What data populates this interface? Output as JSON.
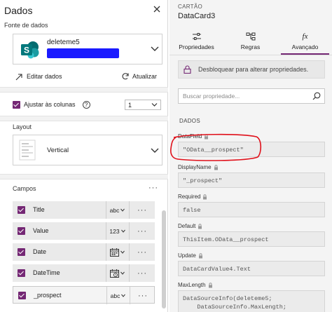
{
  "left_panel": {
    "title": "Dados",
    "data_source_label": "Fonte de dados",
    "data_source_name": "deleteme5",
    "edit_label": "Editar dados",
    "refresh_label": "Atualizar",
    "fit_columns_label": "Ajustar às colunas",
    "columns_value": "1",
    "layout_label": "Layout",
    "layout_value": "Vertical",
    "fields_label": "Campos",
    "fields": [
      {
        "name": "Title",
        "type": "abc"
      },
      {
        "name": "Value",
        "type": "123"
      },
      {
        "name": "Date",
        "type": "calendar-icon"
      },
      {
        "name": "DateTime",
        "type": "calendar-clock-icon"
      },
      {
        "name": "_prospect",
        "type": "abc"
      }
    ]
  },
  "right_panel": {
    "card_label": "CARTÃO",
    "card_name": "DataCard3",
    "tabs": [
      {
        "label": "Propriedades",
        "icon": "sliders-icon"
      },
      {
        "label": "Regras",
        "icon": "rules-icon"
      },
      {
        "label": "Avançado",
        "icon": "fx-icon",
        "active": true
      }
    ],
    "fx_glyph": "fx",
    "unlock_text": "Desbloquear para alterar propriedades.",
    "search_placeholder": "Buscar propriedade...",
    "section_header": "DADOS",
    "properties": [
      {
        "name": "DataField",
        "value": "\"OData__prospect\""
      },
      {
        "name": "DisplayName",
        "value": "\"_prospect\""
      },
      {
        "name": "Required",
        "value": "false"
      },
      {
        "name": "Default",
        "value": "ThisItem.OData__prospect"
      },
      {
        "name": "Update",
        "value": "DataCardValue4.Text"
      },
      {
        "name": "MaxLength",
        "value": "DataSourceInfo(deleteme5;\n    DataSourceInfo.MaxLength;"
      }
    ]
  },
  "colors": {
    "accent": "#742774",
    "sharepoint": "#036c70",
    "annotation_red": "#e0101a",
    "redaction": "#1a1aff"
  }
}
